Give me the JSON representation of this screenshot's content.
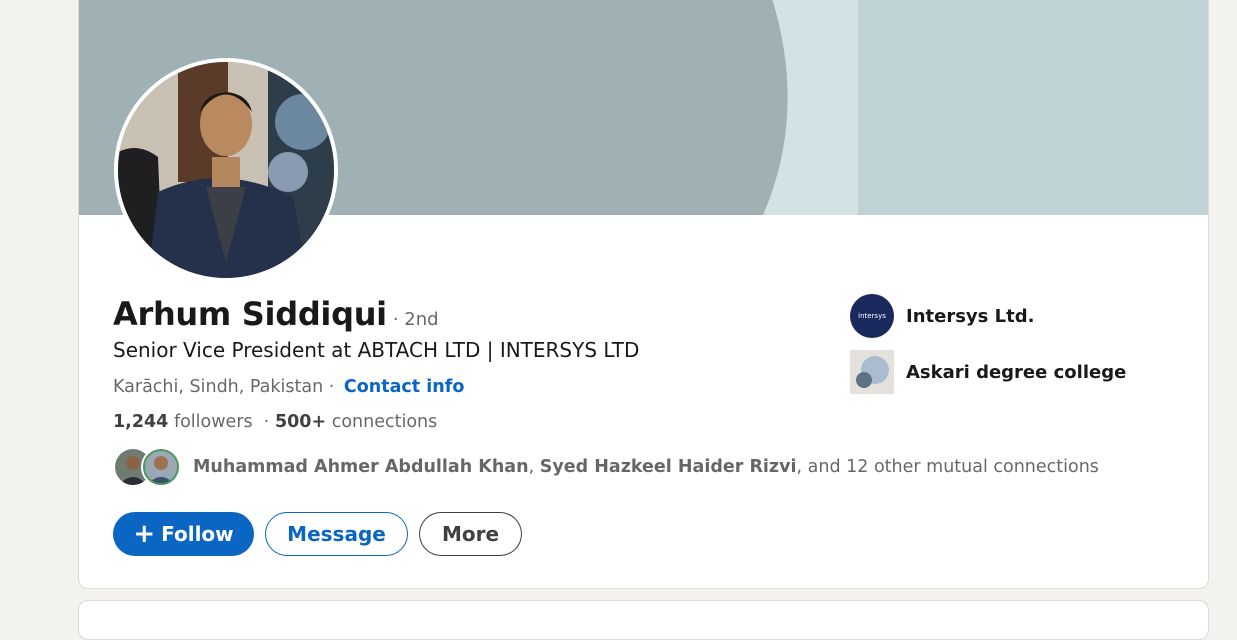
{
  "profile": {
    "name": "Arhum Siddiqui",
    "degree": "· 2nd",
    "headline": "Senior Vice President at ABTACH LTD | INTERSYS LTD",
    "location": "Karāchi, Sindh, Pakistan",
    "location_separator": "·",
    "contact_label": "Contact info",
    "followers_count": "1,244",
    "followers_label": "followers",
    "stats_separator": "·",
    "connections_count": "500+",
    "connections_label": "connections"
  },
  "mutual": {
    "name1": "Muhammad Ahmer Abdullah Khan",
    "sep": ",",
    "name2": "Syed Hazkeel Haider Rizvi",
    "rest": ", and 12 other mutual connections"
  },
  "actions": {
    "follow_icon": "+",
    "follow_label": "Follow",
    "message_label": "Message",
    "more_label": "More"
  },
  "orgs": [
    {
      "name": "Intersys Ltd.",
      "logo_text": "intersys",
      "icon": "company-logo"
    },
    {
      "name": "Askari degree college",
      "icon": "school-logo"
    }
  ],
  "colors": {
    "accent": "#0a66c2",
    "banner_dark": "#9fb1b4",
    "banner_light": "#d3e2e5",
    "banner_right": "#bfd3d6",
    "page_bg": "#f4f2ee"
  }
}
